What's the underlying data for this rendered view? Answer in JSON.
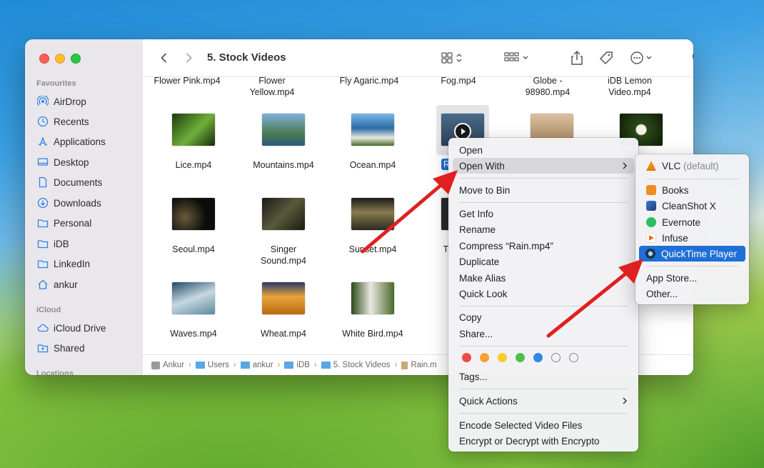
{
  "window": {
    "title": "5. Stock Videos"
  },
  "sidebar": {
    "favourites_label": "Favourites",
    "icloud_label": "iCloud",
    "locations_label": "Locations",
    "items": [
      {
        "label": "AirDrop",
        "icon": "airdrop-icon"
      },
      {
        "label": "Recents",
        "icon": "clock-icon"
      },
      {
        "label": "Applications",
        "icon": "applications-icon"
      },
      {
        "label": "Desktop",
        "icon": "desktop-icon"
      },
      {
        "label": "Documents",
        "icon": "document-icon"
      },
      {
        "label": "Downloads",
        "icon": "download-icon"
      },
      {
        "label": "Personal",
        "icon": "folder-icon"
      },
      {
        "label": "iDB",
        "icon": "folder-icon"
      },
      {
        "label": "LinkedIn",
        "icon": "folder-icon"
      },
      {
        "label": "ankur",
        "icon": "home-icon"
      }
    ],
    "icloud_items": [
      {
        "label": "iCloud Drive",
        "icon": "cloud-icon"
      },
      {
        "label": "Shared",
        "icon": "shared-folder-icon"
      }
    ]
  },
  "files_top_row": [
    {
      "name": "Flower Pink.mp4"
    },
    {
      "name": "Flower Yellow.mp4"
    },
    {
      "name": "Fly Agaric.mp4"
    },
    {
      "name": "Fog.mp4"
    },
    {
      "name": "Globe - 98980.mp4"
    },
    {
      "name": "iDB Lemon Video.mp4"
    }
  ],
  "files": [
    {
      "name": "Lice.mp4",
      "color": "#3f7a1f"
    },
    {
      "name": "Mountains.mp4",
      "color": "#3c7fa0"
    },
    {
      "name": "Ocean.mp4",
      "color": "#2d6a9e"
    },
    {
      "name": "Rain.mp4",
      "color": "#33506d"
    },
    {
      "name": "",
      "color": "#c5a27d"
    },
    {
      "name": "",
      "color": "#1f3a14"
    },
    {
      "name": "Seoul.mp4",
      "color": "#1a1a1a"
    },
    {
      "name": "Singer Sound.mp4",
      "color": "#3a3a2a"
    },
    {
      "name": "Sunset.mp4",
      "color": "#5a4a30"
    },
    {
      "name": "Tr",
      "color": "#2b2b2b"
    },
    {
      "name": "Waves.mp4",
      "color": "#8ba6b5"
    },
    {
      "name": "Wheat.mp4",
      "color": "#c7751c"
    },
    {
      "name": "White Bird.mp4",
      "color": "#3d5a24"
    }
  ],
  "selected_label": "R",
  "pathbar": [
    "Ankur",
    "Users",
    "ankur",
    "iDB",
    "5. Stock Videos",
    "Rain.m"
  ],
  "context_menu": {
    "open": "Open",
    "open_with": "Open With",
    "move_to_bin": "Move to Bin",
    "get_info": "Get Info",
    "rename": "Rename",
    "compress": "Compress “Rain.mp4”",
    "duplicate": "Duplicate",
    "make_alias": "Make Alias",
    "quick_look": "Quick Look",
    "copy": "Copy",
    "share": "Share...",
    "tags": "Tags...",
    "quick_actions": "Quick Actions",
    "encode": "Encode Selected Video Files",
    "encrypt": "Encrypt or Decrypt with Encrypto",
    "tag_colors": [
      "#ee4b48",
      "#f5a133",
      "#f6cd2f",
      "#4fbf4a",
      "#2f87ec",
      "none",
      "none"
    ]
  },
  "open_with_menu": {
    "vlc": "VLC",
    "vlc_default": "(default)",
    "apps": [
      "Books",
      "CleanShot X",
      "Evernote",
      "Infuse",
      "QuickTime Player"
    ],
    "app_store": "App Store...",
    "other": "Other..."
  },
  "colors": {
    "accent": "#1f6fd6",
    "arrow": "#e02020"
  }
}
